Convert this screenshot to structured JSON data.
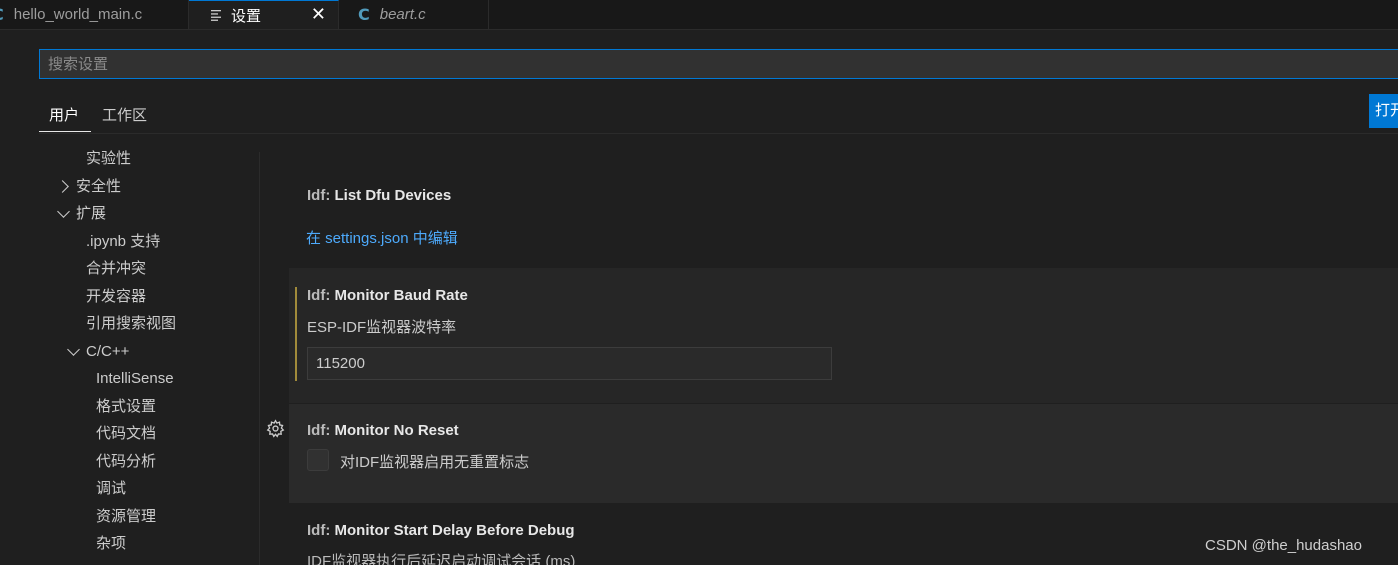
{
  "tabs": [
    {
      "label": "hello_world_main.c",
      "icon": "c-file-icon",
      "active": false
    },
    {
      "label": "设置",
      "icon": "settings-doc-icon",
      "active": true
    },
    {
      "label": "beart.c",
      "icon": "c-file-icon",
      "active": false
    }
  ],
  "tab_icon_c": "C",
  "tab_close": "✕",
  "search": {
    "placeholder": "搜索设置",
    "value": ""
  },
  "scope_tabs": {
    "user": "用户",
    "workspace": "工作区"
  },
  "open_json_label": "打开",
  "toc": [
    {
      "label": "实验性"
    },
    {
      "label": "安全性",
      "collapsed": true
    },
    {
      "label": "扩展",
      "expanded": true
    },
    {
      "label": ".ipynb 支持"
    },
    {
      "label": "合并冲突"
    },
    {
      "label": "开发容器"
    },
    {
      "label": "引用搜索视图"
    },
    {
      "label": "C/C++",
      "expanded": true
    },
    {
      "label": "IntelliSense"
    },
    {
      "label": "格式设置"
    },
    {
      "label": "代码文档"
    },
    {
      "label": "代码分析"
    },
    {
      "label": "调试"
    },
    {
      "label": "资源管理"
    },
    {
      "label": "杂项"
    }
  ],
  "settings": [
    {
      "category": "Idf: ",
      "name": "List Dfu Devices",
      "link": "在 settings.json 中编辑"
    },
    {
      "category": "Idf: ",
      "name": "Monitor Baud Rate",
      "description": "ESP-IDF监视器波特率",
      "value": "115200"
    },
    {
      "category": "Idf: ",
      "name": "Monitor No Reset",
      "description": "对IDF监视器启用无重置标志",
      "checked": false
    },
    {
      "category": "Idf: ",
      "name": "Monitor Start Delay Before Debug",
      "description": "IDF监视器执行后延迟启动调试会话 (ms)"
    }
  ],
  "watermark": "CSDN @the_hudashao",
  "colors": {
    "accent": "#0078d4",
    "link": "#4daafc",
    "modified": "#a08a3a",
    "c_icon": "#519aba"
  }
}
